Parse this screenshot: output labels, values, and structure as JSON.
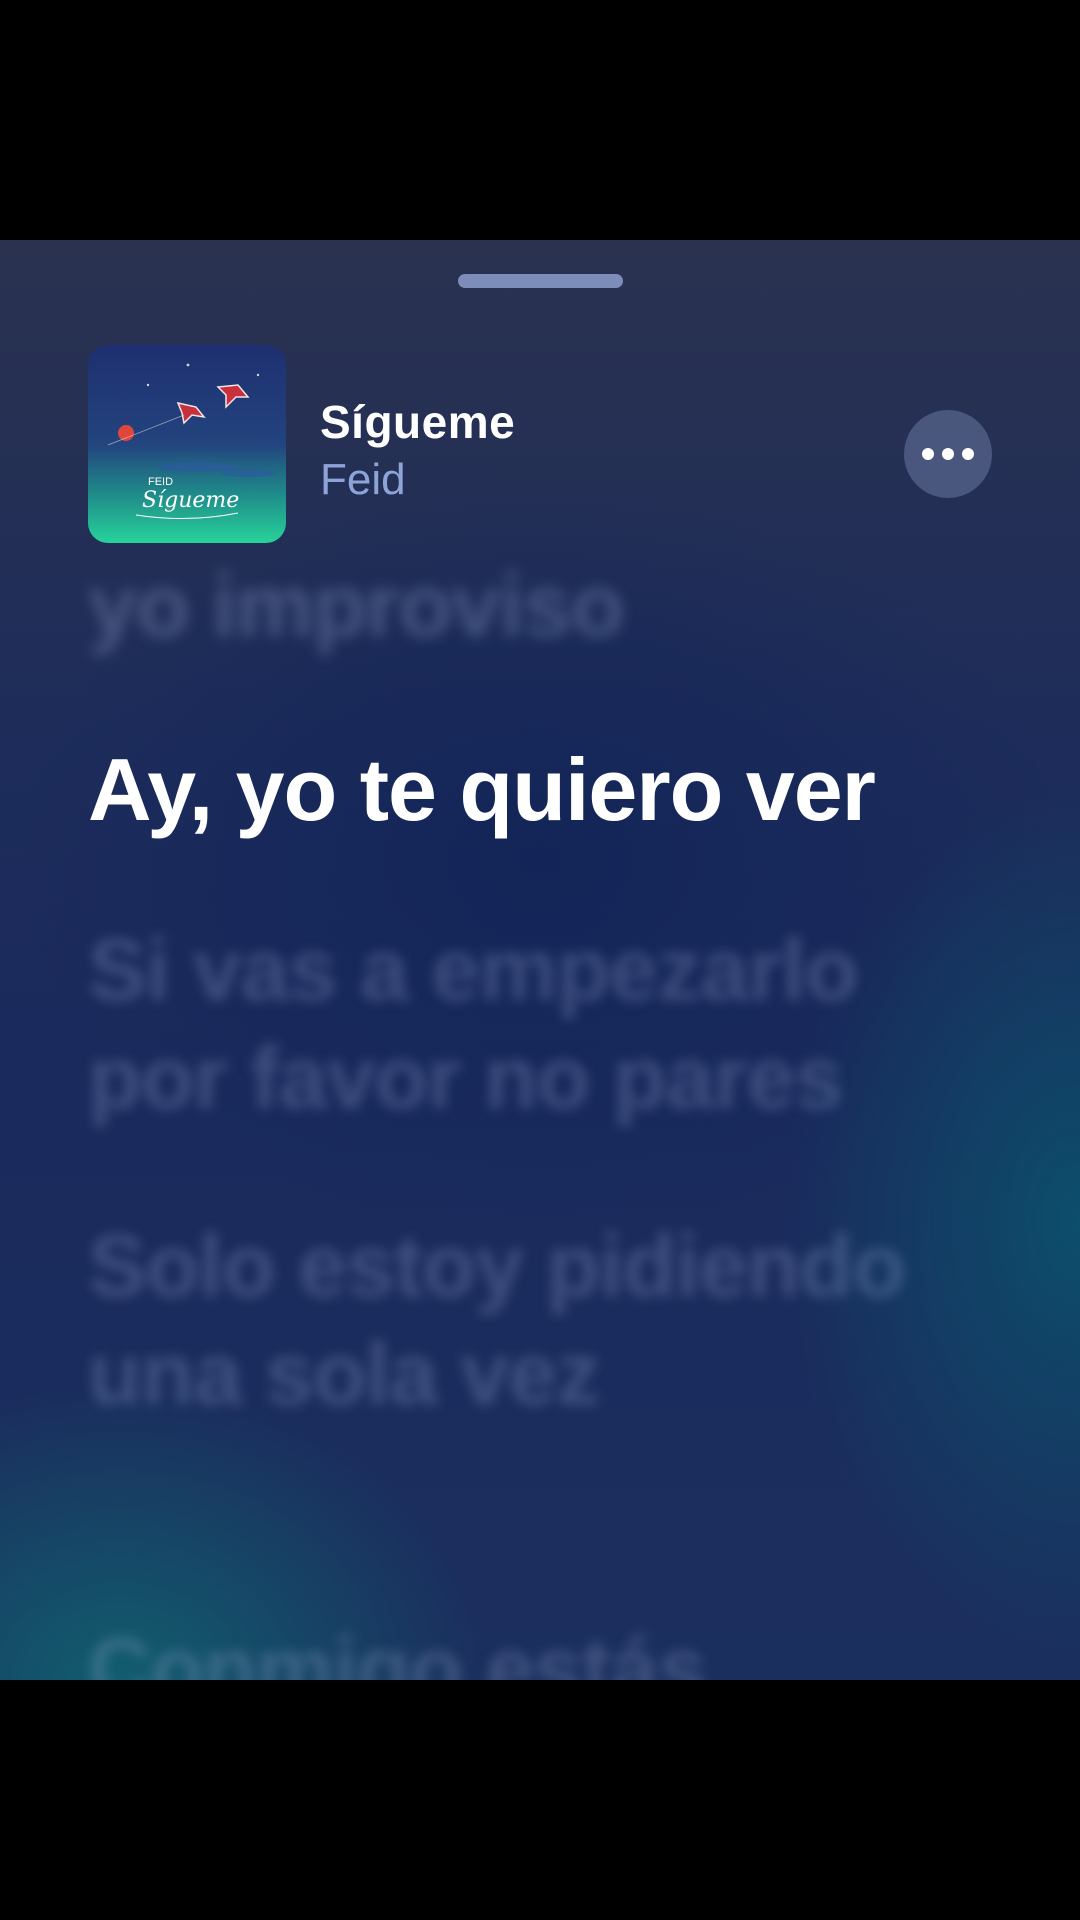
{
  "now_playing": {
    "title": "Sígueme",
    "artist": "Feid",
    "artwork_text": {
      "artist": "FEID",
      "title": "Sígueme"
    }
  },
  "lyrics": {
    "past": "yo improviso",
    "current": "Ay, yo te quiero ver",
    "upcoming": [
      "Si vas a empezarlo por favor no pares",
      "Solo estoy pidiendo una sola vez",
      "Conmigo estás"
    ]
  },
  "icons": {
    "more": "more-ellipsis-icon"
  },
  "colors": {
    "background_top": "#2a3250",
    "background_mid": "#1a2a5c",
    "accent_teal": "#10627a",
    "artist_text": "#8ea4d8",
    "current_lyric": "#ffffff"
  }
}
